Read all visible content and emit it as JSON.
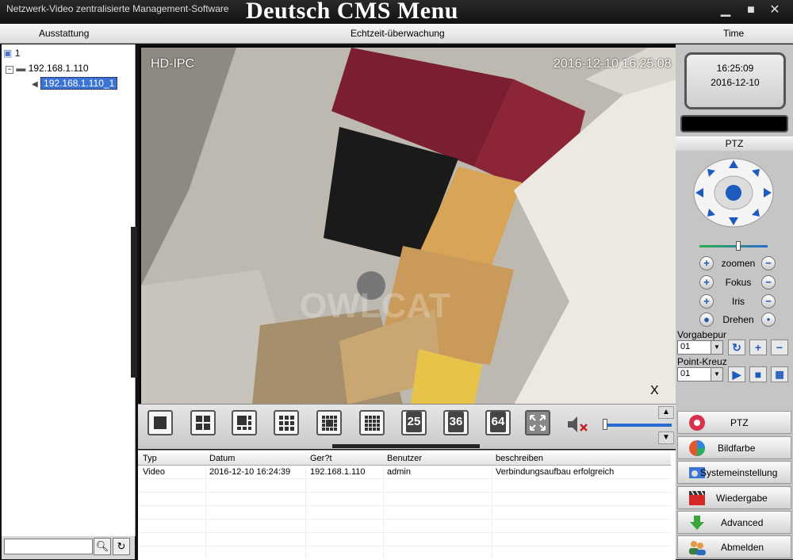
{
  "titlebar": {
    "app_title": "Netzwerk-Video zentralisierte Management-Software",
    "banner": "Deutsch CMS Menu"
  },
  "menubar": {
    "left": "Ausstattung",
    "center": "Echtzeit-überwachung",
    "right": "Time"
  },
  "tree": {
    "root": "1",
    "device": "192.168.1.110",
    "channel": "192.168.1.110_1"
  },
  "video": {
    "cam_label": "HD-IPC",
    "timestamp": "2016-12-10 16:25:08",
    "close": "X",
    "watermark": "OWLCAT"
  },
  "layout_buttons": {
    "n25": "25",
    "n36": "36",
    "n64": "64"
  },
  "log": {
    "headers": [
      "Typ",
      "Datum",
      "Ger?t",
      "Benutzer",
      "beschreiben"
    ],
    "rows": [
      [
        "Video",
        "2016-12-10 16:24:39",
        "192.168.1.110",
        "admin",
        "Verbindungsaufbau erfolgreich"
      ]
    ]
  },
  "clock": {
    "time": "16:25:09",
    "date": "2016-12-10"
  },
  "ptz": {
    "title": "PTZ",
    "zoom": "zoomen",
    "focus": "Fokus",
    "iris": "Iris",
    "rotate": "Drehen",
    "preset_label": "Vorgabepur",
    "preset_value": "01",
    "cross_label": "Point-Kreuz",
    "cross_value": "01"
  },
  "side_menu": [
    "PTZ",
    "Bildfarbe",
    "Systemeinstellung",
    "Wiedergabe",
    "Advanced",
    "Abmelden"
  ],
  "colors": {
    "accent": "#1d5bbf",
    "selection": "#3b73d6"
  }
}
